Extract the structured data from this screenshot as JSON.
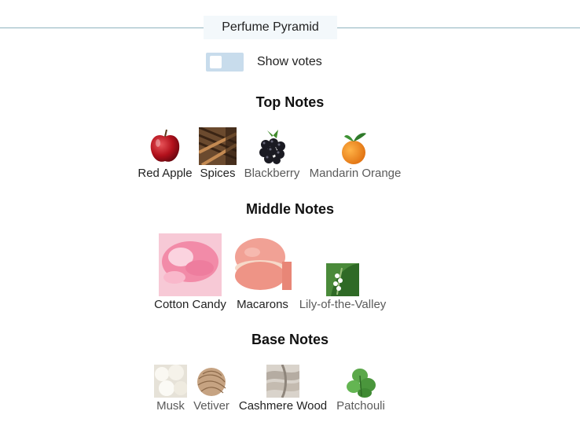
{
  "header": {
    "title": "Perfume Pyramid"
  },
  "toggle": {
    "label": "Show votes",
    "checked": false
  },
  "sections": [
    {
      "title": "Top Notes",
      "notes": [
        "Red Apple",
        "Spices",
        "Blackberry",
        "Mandarin Orange"
      ]
    },
    {
      "title": "Middle Notes",
      "notes": [
        "Cotton Candy",
        "Macarons",
        "Lily-of-the-Valley"
      ]
    },
    {
      "title": "Base Notes",
      "notes": [
        "Musk",
        "Vetiver",
        "Cashmere Wood",
        "Patchouli"
      ]
    }
  ],
  "colors": {
    "rule": "#8fb4bf",
    "header_bg": "#f3f8fb",
    "toggle_bg": "#c8dcec"
  }
}
